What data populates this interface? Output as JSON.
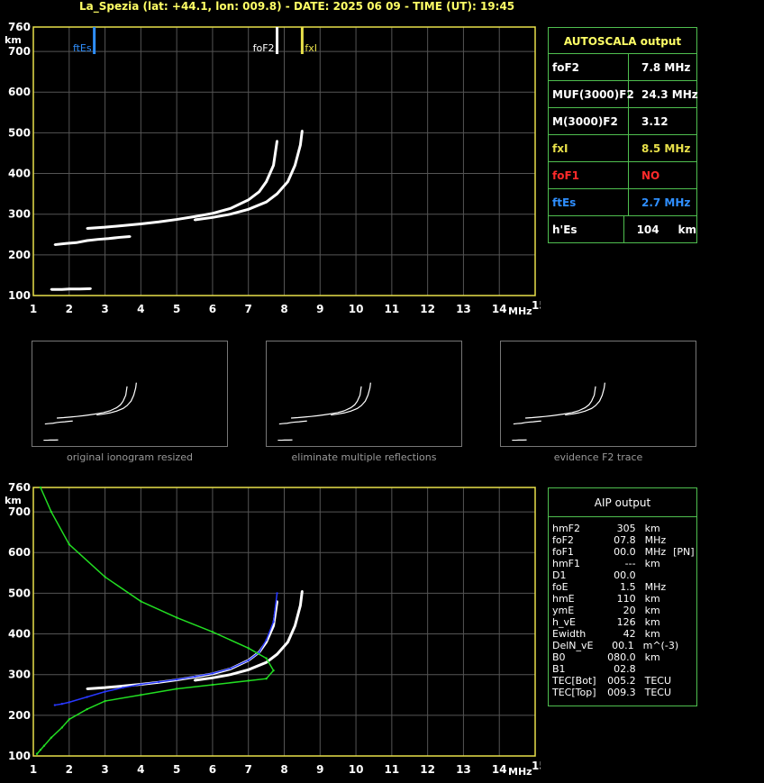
{
  "header": {
    "text": "La_Spezia (lat: +44.1, lon: 009.8) - DATE: 2025 06 09 - TIME (UT): 19:45"
  },
  "autoscala": {
    "title": "AUTOSCALA output",
    "rows": [
      {
        "key": "foF2",
        "value": "7.8 MHz",
        "color": "#ffffff"
      },
      {
        "key": "MUF(3000)F2",
        "value": "24.3 MHz",
        "color": "#ffffff"
      },
      {
        "key": "M(3000)F2",
        "value": "3.12",
        "color": "#ffffff"
      },
      {
        "key": "fxI",
        "value": "8.5 MHz",
        "color": "#e8e04a"
      },
      {
        "key": "foF1",
        "value": "NO",
        "color": "#ff2a2a"
      },
      {
        "key": "ftEs",
        "value": "2.7 MHz",
        "color": "#2f8fff"
      },
      {
        "key": "h'Es",
        "value": "104     km",
        "color": "#ffffff"
      }
    ]
  },
  "aip": {
    "title": "AIP output",
    "rows": [
      [
        "hmF2",
        "305",
        "km",
        ""
      ],
      [
        "foF2",
        "07.8",
        "MHz",
        ""
      ],
      [
        "foF1",
        "00.0",
        "MHz",
        "[PN]"
      ],
      [
        "hmF1",
        "---",
        "km",
        ""
      ],
      [
        "D1",
        "00.0",
        "",
        ""
      ],
      [
        "foE",
        "1.5",
        "MHz",
        ""
      ],
      [
        "hmE",
        "110",
        "km",
        ""
      ],
      [
        "ymE",
        "20",
        "km",
        ""
      ],
      [
        "h_vE",
        "126",
        "km",
        ""
      ],
      [
        "Ewidth",
        "42",
        "km",
        ""
      ],
      [
        "DelN_vE",
        "00.1",
        "m^(-3)",
        ""
      ],
      [
        "B0",
        "080.0",
        "km",
        ""
      ],
      [
        "B1",
        "02.8",
        "",
        ""
      ],
      [
        "TEC[Bot]",
        "005.2",
        "TECU",
        ""
      ],
      [
        "TEC[Top]",
        "009.3",
        "TECU",
        ""
      ]
    ]
  },
  "captions": [
    "original ionogram resized",
    "eliminate multiple reflections",
    "evidence F2 trace"
  ],
  "chart_data": [
    {
      "type": "scatter",
      "title": "",
      "xlabel": "MHz",
      "ylabel": "km",
      "xlim": [
        1,
        15
      ],
      "ylim": [
        100,
        760
      ],
      "xticks": [
        1,
        2,
        3,
        4,
        5,
        6,
        7,
        8,
        9,
        10,
        11,
        12,
        13,
        14,
        15
      ],
      "yticks": [
        100,
        200,
        300,
        400,
        500,
        600,
        700,
        760
      ],
      "grid": true,
      "markers": [
        {
          "name": "ftEs",
          "x": 2.7,
          "color": "#2f8fff"
        },
        {
          "name": "foF2",
          "x": 7.8,
          "color": "#ffffff"
        },
        {
          "name": "fxI",
          "x": 8.5,
          "color": "#e8e04a"
        }
      ],
      "series": [
        {
          "color": "#ffffff",
          "x": [
            2.5,
            3,
            3.5,
            4,
            4.5,
            5,
            5.5,
            6,
            6.5,
            7,
            7.3,
            7.5,
            7.7,
            7.8
          ],
          "y": [
            265,
            268,
            272,
            276,
            281,
            287,
            294,
            302,
            314,
            335,
            355,
            380,
            420,
            480
          ]
        },
        {
          "color": "#ffffff",
          "x": [
            5.5,
            6,
            6.5,
            7,
            7.5,
            7.8,
            8.1,
            8.3,
            8.45,
            8.5
          ],
          "y": [
            286,
            292,
            300,
            312,
            330,
            350,
            380,
            420,
            470,
            505
          ]
        },
        {
          "color": "#ffffff",
          "x": [
            1.5,
            1.8,
            2,
            2.3,
            2.6
          ],
          "y": [
            115,
            115,
            116,
            116,
            117
          ]
        },
        {
          "color": "#ffffff",
          "x": [
            1.6,
            1.9,
            2.2,
            2.5,
            2.8,
            3.1,
            3.4,
            3.7
          ],
          "y": [
            225,
            228,
            230,
            235,
            238,
            240,
            243,
            245
          ]
        }
      ]
    },
    {
      "type": "line",
      "title": "",
      "xlabel": "MHz",
      "ylabel": "km",
      "xlim": [
        1,
        15
      ],
      "ylim": [
        100,
        760
      ],
      "xticks": [
        1,
        2,
        3,
        4,
        5,
        6,
        7,
        8,
        9,
        10,
        11,
        12,
        13,
        14,
        15
      ],
      "yticks": [
        100,
        200,
        300,
        400,
        500,
        600,
        700,
        760
      ],
      "grid": true,
      "series": [
        {
          "color": "#ffffff",
          "x": [
            2.5,
            3,
            3.5,
            4,
            4.5,
            5,
            5.5,
            6,
            6.5,
            7,
            7.3,
            7.5,
            7.7,
            7.8
          ],
          "y": [
            265,
            268,
            272,
            276,
            281,
            287,
            294,
            302,
            314,
            335,
            355,
            380,
            420,
            480
          ]
        },
        {
          "color": "#ffffff",
          "x": [
            5.5,
            6,
            6.5,
            7,
            7.5,
            7.8,
            8.1,
            8.3,
            8.45,
            8.5
          ],
          "y": [
            286,
            292,
            300,
            312,
            330,
            350,
            380,
            420,
            470,
            505
          ]
        },
        {
          "color": "#2838ff",
          "x": [
            1.6,
            1.8,
            2,
            2.5,
            3,
            3.5,
            4,
            4.5,
            5,
            5.5,
            6,
            6.5,
            7,
            7.3,
            7.5,
            7.7,
            7.8
          ],
          "y": [
            225,
            228,
            232,
            245,
            258,
            268,
            276,
            282,
            288,
            295,
            303,
            315,
            335,
            355,
            385,
            430,
            500
          ]
        },
        {
          "color": "#22dd22",
          "x": [
            1.2,
            1.5,
            2,
            3,
            4,
            5,
            6,
            7,
            7.5,
            7.7,
            7.5,
            7,
            6,
            5,
            4,
            3,
            2.5,
            2,
            1.8,
            1.5,
            1.3,
            1.2,
            1.1
          ],
          "y": [
            760,
            700,
            620,
            540,
            480,
            440,
            405,
            365,
            340,
            310,
            290,
            285,
            275,
            265,
            250,
            235,
            215,
            190,
            170,
            145,
            125,
            115,
            105
          ]
        }
      ]
    }
  ]
}
